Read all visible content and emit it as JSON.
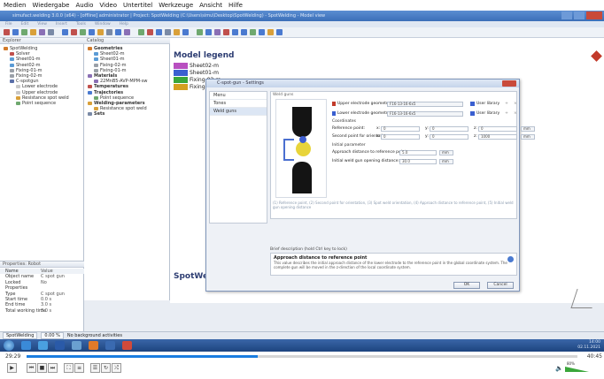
{
  "menubar": [
    "Medien",
    "Wiedergabe",
    "Audio",
    "Video",
    "Untertitel",
    "Werkzeuge",
    "Ansicht",
    "Hilfe"
  ],
  "app": {
    "title": "simufact.welding 3.0.0 (x64) - [offline] administrator | Project: SpotWelding (C:\\Users\\simu\\Desktop\\SpotWelding) - SpotWelding - Model view",
    "ribbon_items": [
      "File",
      "Edit",
      "View",
      "Insert",
      "Tools",
      "Window",
      "Help"
    ]
  },
  "explorer": {
    "header": "Explorer",
    "items": [
      {
        "label": "SpotWelding",
        "level": 0,
        "color": "#d27a2a",
        "bold": false
      },
      {
        "label": "Solver",
        "level": 1,
        "color": "#c0504d",
        "bold": false
      },
      {
        "label": "Sheet01-m",
        "level": 1,
        "color": "#5b9bd5",
        "bold": false
      },
      {
        "label": "Sheet02-m",
        "level": 1,
        "color": "#5b9bd5",
        "bold": false
      },
      {
        "label": "Fixing-01-m",
        "level": 1,
        "color": "#9aa0a8",
        "bold": false
      },
      {
        "label": "Fixing-02-m",
        "level": 1,
        "color": "#9aa0a8",
        "bold": false
      },
      {
        "label": "C-spotgun",
        "level": 1,
        "color": "#5a6fa8",
        "bold": false
      },
      {
        "label": "Lower electrode",
        "level": 2,
        "color": "#c8c8c8",
        "bold": false
      },
      {
        "label": "Upper electrode",
        "level": 2,
        "color": "#c8c8c8",
        "bold": false
      },
      {
        "label": "Resistance spot weld",
        "level": 2,
        "color": "#d9a03a",
        "bold": false
      },
      {
        "label": "Point sequence",
        "level": 2,
        "color": "#6fa86f",
        "bold": false
      }
    ]
  },
  "catalog": {
    "header": "Catalog",
    "items": [
      {
        "label": "Geometries",
        "level": 0,
        "color": "#d27a2a",
        "bold": true
      },
      {
        "label": "Sheet02-m",
        "level": 1,
        "color": "#5b9bd5",
        "bold": false
      },
      {
        "label": "Sheet01-m",
        "level": 1,
        "color": "#5b9bd5",
        "bold": false
      },
      {
        "label": "Fixing-02-m",
        "level": 1,
        "color": "#9aa0a8",
        "bold": false
      },
      {
        "label": "Fixing-01-m",
        "level": 1,
        "color": "#9aa0a8",
        "bold": false
      },
      {
        "label": "Materials",
        "level": 0,
        "color": "#8a6fb5",
        "bold": true
      },
      {
        "label": "22MnB5-AVP-MPM-sw",
        "level": 1,
        "color": "#8a6fb5",
        "bold": false
      },
      {
        "label": "Temperatures",
        "level": 0,
        "color": "#c0504d",
        "bold": true
      },
      {
        "label": "Trajectories",
        "level": 0,
        "color": "#4a7ad0",
        "bold": true
      },
      {
        "label": "Point sequence",
        "level": 1,
        "color": "#6fa86f",
        "bold": false
      },
      {
        "label": "Welding-parameters",
        "level": 0,
        "color": "#d9a03a",
        "bold": true
      },
      {
        "label": "Resistance spot weld",
        "level": 1,
        "color": "#d9a03a",
        "bold": false
      },
      {
        "label": "Sets",
        "level": 0,
        "color": "#7a8aa6",
        "bold": true
      }
    ]
  },
  "properties": {
    "header": "Properties: Robot",
    "columns": [
      "Name",
      "Value"
    ],
    "rows": [
      {
        "k": "Object name",
        "v": "C spot gun"
      },
      {
        "k": "Locked",
        "v": "No"
      },
      {
        "k": "Properties",
        "v": ""
      },
      {
        "k": "Type",
        "v": "C spot gun"
      },
      {
        "k": "Start time",
        "v": "0.0 s"
      },
      {
        "k": "End time",
        "v": "3.0 s"
      },
      {
        "k": "Total working time",
        "v": "3.0 s"
      }
    ]
  },
  "model": {
    "legend_title": "Model legend",
    "legend": [
      {
        "label": "Sheet02-m",
        "color": "#b84fc0"
      },
      {
        "label": "Sheet01-m",
        "color": "#3a5fd0"
      },
      {
        "label": "Fixing-02-m",
        "color": "#3aa63a"
      },
      {
        "label": "Fixing-01-m",
        "color": "#d4a020"
      }
    ],
    "footer": "SpotWelding - Model view"
  },
  "statusbar": {
    "item1": "SpotWelding",
    "zoom": "0.00 %",
    "status": "No background activities"
  },
  "dialog": {
    "title": "C-spot-gun - Settings",
    "nav": [
      "Menu",
      "Tones",
      "Weld guns"
    ],
    "nav_selected": 2,
    "group": "Weld guns",
    "upper_label": "Upper electrode geometry:",
    "upper_value": "F16-13-16-6x5",
    "lower_label": "Lower electrode geometry:",
    "lower_value": "F16-13-16-6x5",
    "user_library": "User library",
    "coordinates": "Coordinates",
    "ref_point": "Reference point:",
    "second_point": "Second point for orientation:",
    "x_label": "x:",
    "y_label": "y:",
    "z_label": "z:",
    "ref_x": "0",
    "ref_y": "0",
    "ref_z": "0",
    "sec_x": "0",
    "sec_y": "0",
    "sec_z": "1000",
    "unit": "mm",
    "initial_params": "Initial parameter",
    "approach_label": "Approach distance to reference point:",
    "approach_value": "5.0",
    "opening_label": "Initial weld gun opening distance:",
    "opening_value": "30.0",
    "hint": "(1) Reference point, (2) Second point for orientation, (3) Spot weld orientation, (4) Approach distance to reference point, (5) Initial weld gun opening distance",
    "desc_label": "Brief description (hold Ctrl key to lock)",
    "desc_title": "Approach distance to reference point",
    "desc_text": "This value describes the initial approach distance of the lower electrode to the reference point in the global coordinate system. The complete gun will be moved in the z-direction of the local coordinate system.",
    "ok": "OK",
    "cancel": "Cancel"
  },
  "taskbar": {
    "time": "14:00",
    "date": "02.11.2021"
  },
  "player": {
    "elapsed": "29:29",
    "remaining": "40:45",
    "progress": 0.42,
    "volume_label": "80%",
    "volume": 0.8
  }
}
